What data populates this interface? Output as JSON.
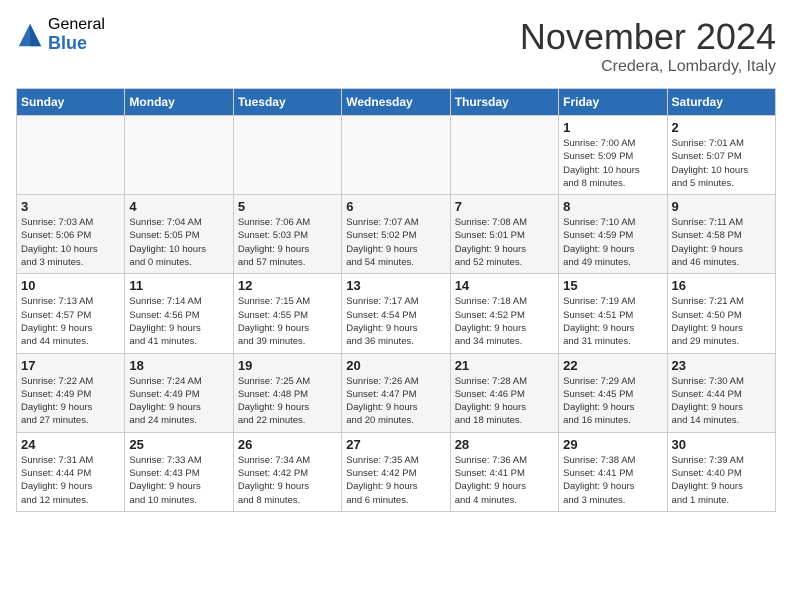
{
  "header": {
    "logo_general": "General",
    "logo_blue": "Blue",
    "month_title": "November 2024",
    "location": "Credera, Lombardy, Italy"
  },
  "calendar": {
    "columns": [
      "Sunday",
      "Monday",
      "Tuesday",
      "Wednesday",
      "Thursday",
      "Friday",
      "Saturday"
    ],
    "weeks": [
      [
        {
          "day": "",
          "info": ""
        },
        {
          "day": "",
          "info": ""
        },
        {
          "day": "",
          "info": ""
        },
        {
          "day": "",
          "info": ""
        },
        {
          "day": "",
          "info": ""
        },
        {
          "day": "1",
          "info": "Sunrise: 7:00 AM\nSunset: 5:09 PM\nDaylight: 10 hours\nand 8 minutes."
        },
        {
          "day": "2",
          "info": "Sunrise: 7:01 AM\nSunset: 5:07 PM\nDaylight: 10 hours\nand 5 minutes."
        }
      ],
      [
        {
          "day": "3",
          "info": "Sunrise: 7:03 AM\nSunset: 5:06 PM\nDaylight: 10 hours\nand 3 minutes."
        },
        {
          "day": "4",
          "info": "Sunrise: 7:04 AM\nSunset: 5:05 PM\nDaylight: 10 hours\nand 0 minutes."
        },
        {
          "day": "5",
          "info": "Sunrise: 7:06 AM\nSunset: 5:03 PM\nDaylight: 9 hours\nand 57 minutes."
        },
        {
          "day": "6",
          "info": "Sunrise: 7:07 AM\nSunset: 5:02 PM\nDaylight: 9 hours\nand 54 minutes."
        },
        {
          "day": "7",
          "info": "Sunrise: 7:08 AM\nSunset: 5:01 PM\nDaylight: 9 hours\nand 52 minutes."
        },
        {
          "day": "8",
          "info": "Sunrise: 7:10 AM\nSunset: 4:59 PM\nDaylight: 9 hours\nand 49 minutes."
        },
        {
          "day": "9",
          "info": "Sunrise: 7:11 AM\nSunset: 4:58 PM\nDaylight: 9 hours\nand 46 minutes."
        }
      ],
      [
        {
          "day": "10",
          "info": "Sunrise: 7:13 AM\nSunset: 4:57 PM\nDaylight: 9 hours\nand 44 minutes."
        },
        {
          "day": "11",
          "info": "Sunrise: 7:14 AM\nSunset: 4:56 PM\nDaylight: 9 hours\nand 41 minutes."
        },
        {
          "day": "12",
          "info": "Sunrise: 7:15 AM\nSunset: 4:55 PM\nDaylight: 9 hours\nand 39 minutes."
        },
        {
          "day": "13",
          "info": "Sunrise: 7:17 AM\nSunset: 4:54 PM\nDaylight: 9 hours\nand 36 minutes."
        },
        {
          "day": "14",
          "info": "Sunrise: 7:18 AM\nSunset: 4:52 PM\nDaylight: 9 hours\nand 34 minutes."
        },
        {
          "day": "15",
          "info": "Sunrise: 7:19 AM\nSunset: 4:51 PM\nDaylight: 9 hours\nand 31 minutes."
        },
        {
          "day": "16",
          "info": "Sunrise: 7:21 AM\nSunset: 4:50 PM\nDaylight: 9 hours\nand 29 minutes."
        }
      ],
      [
        {
          "day": "17",
          "info": "Sunrise: 7:22 AM\nSunset: 4:49 PM\nDaylight: 9 hours\nand 27 minutes."
        },
        {
          "day": "18",
          "info": "Sunrise: 7:24 AM\nSunset: 4:49 PM\nDaylight: 9 hours\nand 24 minutes."
        },
        {
          "day": "19",
          "info": "Sunrise: 7:25 AM\nSunset: 4:48 PM\nDaylight: 9 hours\nand 22 minutes."
        },
        {
          "day": "20",
          "info": "Sunrise: 7:26 AM\nSunset: 4:47 PM\nDaylight: 9 hours\nand 20 minutes."
        },
        {
          "day": "21",
          "info": "Sunrise: 7:28 AM\nSunset: 4:46 PM\nDaylight: 9 hours\nand 18 minutes."
        },
        {
          "day": "22",
          "info": "Sunrise: 7:29 AM\nSunset: 4:45 PM\nDaylight: 9 hours\nand 16 minutes."
        },
        {
          "day": "23",
          "info": "Sunrise: 7:30 AM\nSunset: 4:44 PM\nDaylight: 9 hours\nand 14 minutes."
        }
      ],
      [
        {
          "day": "24",
          "info": "Sunrise: 7:31 AM\nSunset: 4:44 PM\nDaylight: 9 hours\nand 12 minutes."
        },
        {
          "day": "25",
          "info": "Sunrise: 7:33 AM\nSunset: 4:43 PM\nDaylight: 9 hours\nand 10 minutes."
        },
        {
          "day": "26",
          "info": "Sunrise: 7:34 AM\nSunset: 4:42 PM\nDaylight: 9 hours\nand 8 minutes."
        },
        {
          "day": "27",
          "info": "Sunrise: 7:35 AM\nSunset: 4:42 PM\nDaylight: 9 hours\nand 6 minutes."
        },
        {
          "day": "28",
          "info": "Sunrise: 7:36 AM\nSunset: 4:41 PM\nDaylight: 9 hours\nand 4 minutes."
        },
        {
          "day": "29",
          "info": "Sunrise: 7:38 AM\nSunset: 4:41 PM\nDaylight: 9 hours\nand 3 minutes."
        },
        {
          "day": "30",
          "info": "Sunrise: 7:39 AM\nSunset: 4:40 PM\nDaylight: 9 hours\nand 1 minute."
        }
      ]
    ]
  }
}
